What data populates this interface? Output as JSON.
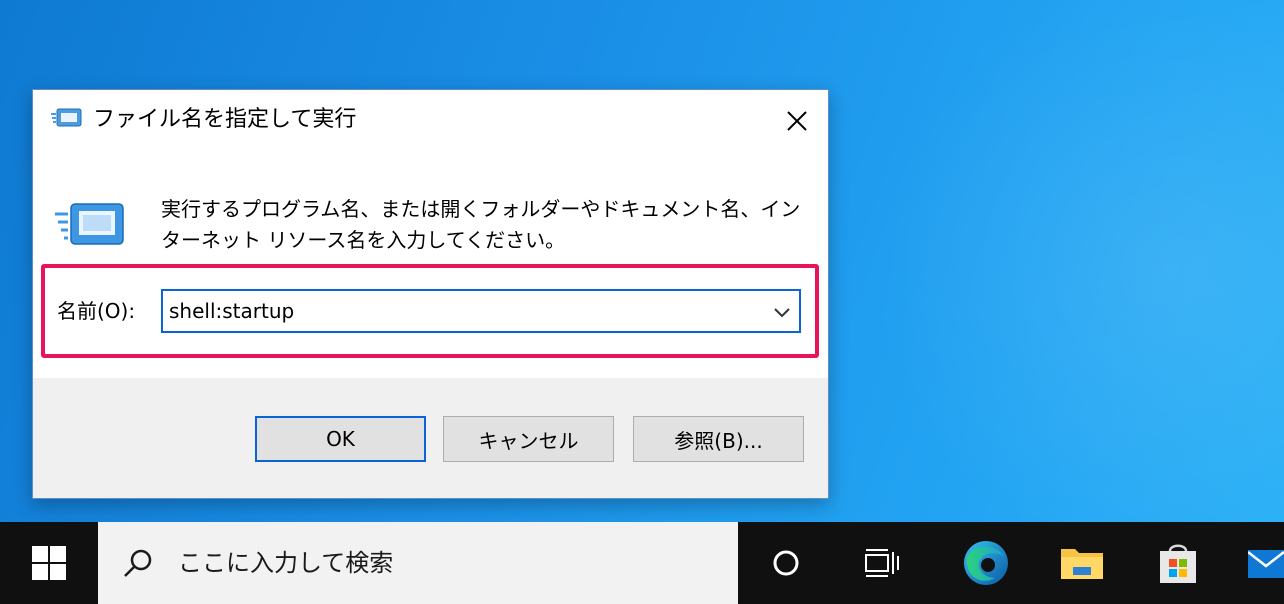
{
  "dialog": {
    "title": "ファイル名を指定して実行",
    "description": "実行するプログラム名、または開くフォルダーやドキュメント名、インターネット リソース名を入力してください。",
    "name_label": "名前(O):",
    "name_value": "shell:startup",
    "buttons": {
      "ok": "OK",
      "cancel": "キャンセル",
      "browse": "参照(B)..."
    }
  },
  "taskbar": {
    "search_placeholder": "ここに入力して検索",
    "items": [
      "start-icon",
      "search-icon",
      "cortana-icon",
      "task-view-icon",
      "edge-icon",
      "file-explorer-icon",
      "store-icon",
      "mail-icon"
    ]
  },
  "colors": {
    "highlight": "#e8145a",
    "focus": "#0a64d6",
    "taskbar": "#101010"
  }
}
